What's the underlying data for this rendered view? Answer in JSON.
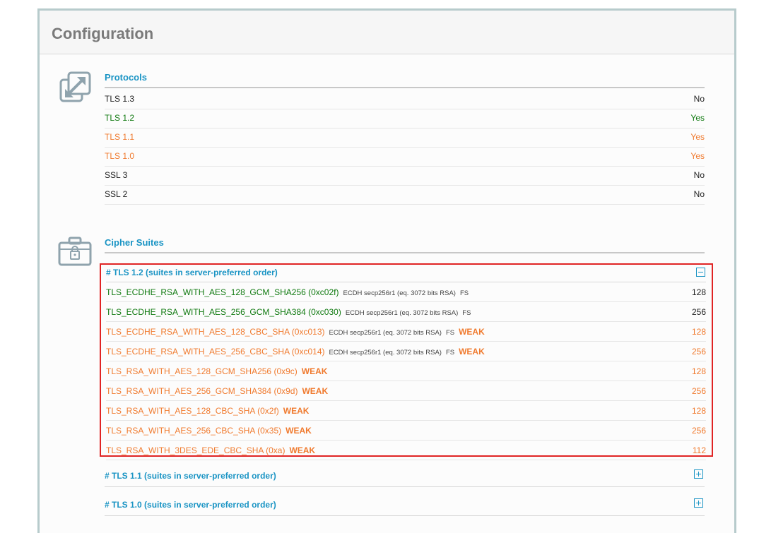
{
  "panel": {
    "title": "Configuration"
  },
  "protocols": {
    "title": "Protocols",
    "icon": "expand-arrows-icon",
    "rows": [
      {
        "name": "TLS 1.3",
        "value": "No",
        "status": "neutral"
      },
      {
        "name": "TLS 1.2",
        "value": "Yes",
        "status": "good"
      },
      {
        "name": "TLS 1.1",
        "value": "Yes",
        "status": "warn"
      },
      {
        "name": "TLS 1.0",
        "value": "Yes",
        "status": "warn"
      },
      {
        "name": "SSL 3",
        "value": "No",
        "status": "neutral"
      },
      {
        "name": "SSL 2",
        "value": "No",
        "status": "neutral"
      }
    ]
  },
  "cipher_suites": {
    "title": "Cipher Suites",
    "icon": "briefcase-lock-icon",
    "groups": [
      {
        "heading": "# TLS 1.2 (suites in server-preferred order)",
        "toggle": "collapse-icon",
        "suites": [
          {
            "name": "TLS_ECDHE_RSA_WITH_AES_128_GCM_SHA256",
            "code": "(0xc02f)",
            "detail": "ECDH secp256r1 (eq. 3072 bits RSA)",
            "fs": "FS",
            "weak": "",
            "bits": "128",
            "status": "good"
          },
          {
            "name": "TLS_ECDHE_RSA_WITH_AES_256_GCM_SHA384",
            "code": "(0xc030)",
            "detail": "ECDH secp256r1 (eq. 3072 bits RSA)",
            "fs": "FS",
            "weak": "",
            "bits": "256",
            "status": "good"
          },
          {
            "name": "TLS_ECDHE_RSA_WITH_AES_128_CBC_SHA",
            "code": "(0xc013)",
            "detail": "ECDH secp256r1 (eq. 3072 bits RSA)",
            "fs": "FS",
            "weak": "WEAK",
            "bits": "128",
            "status": "warn"
          },
          {
            "name": "TLS_ECDHE_RSA_WITH_AES_256_CBC_SHA",
            "code": "(0xc014)",
            "detail": "ECDH secp256r1 (eq. 3072 bits RSA)",
            "fs": "FS",
            "weak": "WEAK",
            "bits": "256",
            "status": "warn"
          },
          {
            "name": "TLS_RSA_WITH_AES_128_GCM_SHA256",
            "code": "(0x9c)",
            "detail": "",
            "fs": "",
            "weak": "WEAK",
            "bits": "128",
            "status": "warn"
          },
          {
            "name": "TLS_RSA_WITH_AES_256_GCM_SHA384",
            "code": "(0x9d)",
            "detail": "",
            "fs": "",
            "weak": "WEAK",
            "bits": "256",
            "status": "warn"
          },
          {
            "name": "TLS_RSA_WITH_AES_128_CBC_SHA",
            "code": "(0x2f)",
            "detail": "",
            "fs": "",
            "weak": "WEAK",
            "bits": "128",
            "status": "warn"
          },
          {
            "name": "TLS_RSA_WITH_AES_256_CBC_SHA",
            "code": "(0x35)",
            "detail": "",
            "fs": "",
            "weak": "WEAK",
            "bits": "256",
            "status": "warn"
          },
          {
            "name": "TLS_RSA_WITH_3DES_EDE_CBC_SHA",
            "code": "(0xa)",
            "detail": "",
            "fs": "",
            "weak": "WEAK",
            "bits": "112",
            "status": "warn"
          }
        ]
      },
      {
        "heading": "# TLS 1.1 (suites in server-preferred order)",
        "toggle": "expand-icon"
      },
      {
        "heading": "# TLS 1.0 (suites in server-preferred order)",
        "toggle": "expand-icon"
      }
    ]
  },
  "colors": {
    "good": "#117a11",
    "warn": "#f07a2e",
    "neutral": "#222222",
    "accent": "#1a94c4",
    "highlight_border": "#e02424"
  }
}
